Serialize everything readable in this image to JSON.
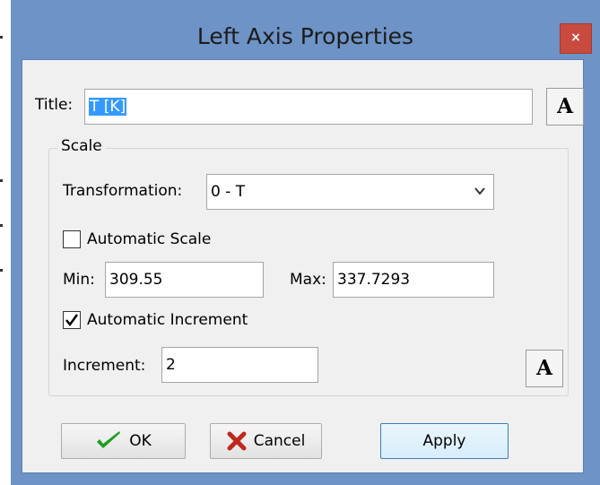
{
  "window": {
    "title": "Left Axis Properties",
    "close_glyph": "×"
  },
  "title_field": {
    "label": "Title:",
    "value": "T [K]"
  },
  "font_button_glyph": "A",
  "scale": {
    "legend": "Scale",
    "transformation": {
      "label": "Transformation:",
      "value": "0 - T"
    },
    "automatic_scale": {
      "label": "Automatic Scale",
      "checked": false
    },
    "min": {
      "label": "Min:",
      "value": "309.55"
    },
    "max": {
      "label": "Max:",
      "value": "337.7293"
    },
    "automatic_increment": {
      "label": "Automatic Increment",
      "checked": true
    },
    "increment": {
      "label": "Increment:",
      "value": "2"
    }
  },
  "buttons": {
    "ok": "OK",
    "cancel": "Cancel",
    "apply": "Apply"
  },
  "colors": {
    "title_bar": "#6e93c6",
    "close": "#c94a3f",
    "dialog_bg": "#f0f0f0",
    "ok_check": "#1f9e1f",
    "cancel_x": "#c0271c",
    "selection": "#3399ff"
  },
  "icons": [
    "close-icon",
    "font-icon",
    "chevron-down-icon",
    "checkmark-icon",
    "ok-check-icon",
    "cancel-x-icon"
  ]
}
